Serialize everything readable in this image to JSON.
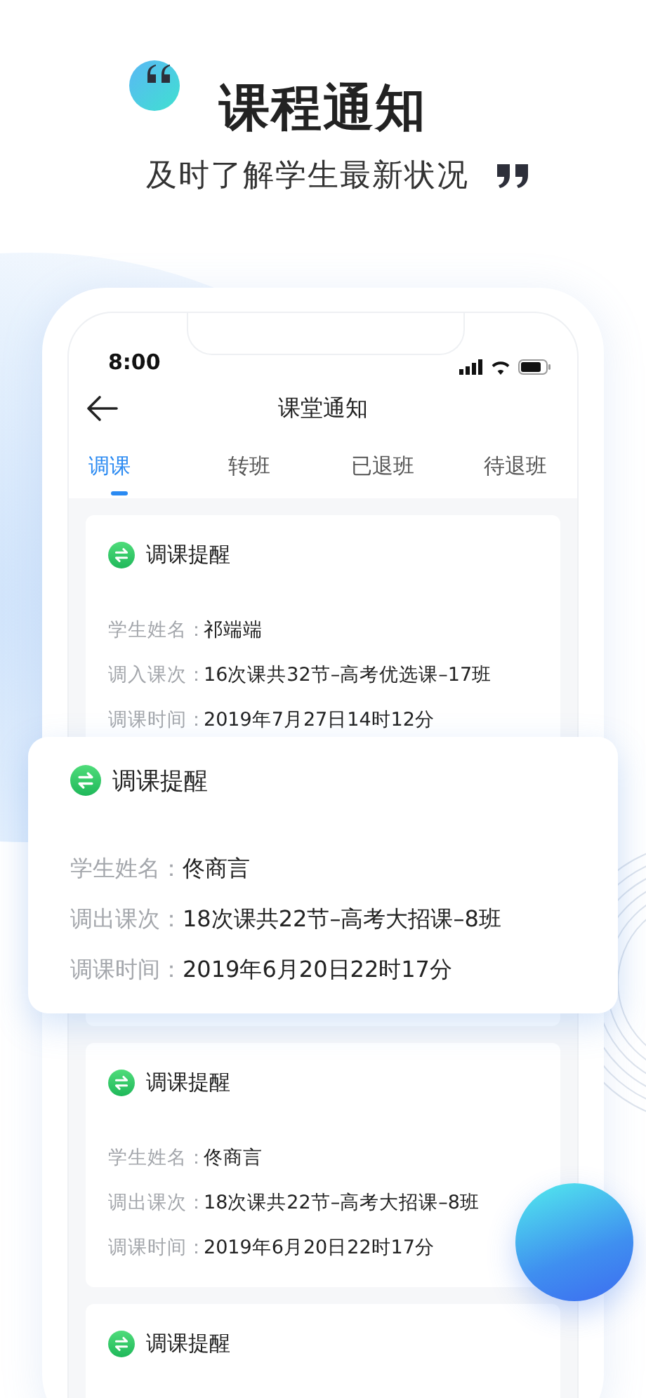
{
  "headline": {
    "title": "课程通知",
    "subtitle": "及时了解学生最新状况"
  },
  "status_bar": {
    "time": "8:00"
  },
  "nav": {
    "title": "课堂通知"
  },
  "tabs": [
    {
      "label": "调课",
      "selected": true
    },
    {
      "label": "转班",
      "selected": false
    },
    {
      "label": "已退班",
      "selected": false
    },
    {
      "label": "待退班",
      "selected": false
    }
  ],
  "cards": [
    {
      "title": "调课提醒",
      "fields": [
        {
          "label": "学生姓名：",
          "value": "祁端端"
        },
        {
          "label": "调入课次：",
          "value": "16次课共32节–高考优选课–17班"
        },
        {
          "label": "调课时间：",
          "value": "2019年7月27日14时12分"
        }
      ]
    },
    {
      "title": "调课提醒",
      "fields": [
        {
          "label": "学生姓名：",
          "value": "佟商言"
        },
        {
          "label": "调出课次：",
          "value": "18次课共22节–高考大招课–8班"
        },
        {
          "label": "调课时间：",
          "value": "2019年6月20日22时17分"
        }
      ]
    },
    {
      "title": "调课提醒"
    }
  ],
  "featured_card": {
    "title": "调课提醒",
    "fields": [
      {
        "label": "学生姓名：",
        "value": "佟商言"
      },
      {
        "label": "调出课次：",
        "value": "18次课共22节–高考大招课–8班"
      },
      {
        "label": "调课时间：",
        "value": "2019年6月20日22时17分"
      }
    ]
  }
}
